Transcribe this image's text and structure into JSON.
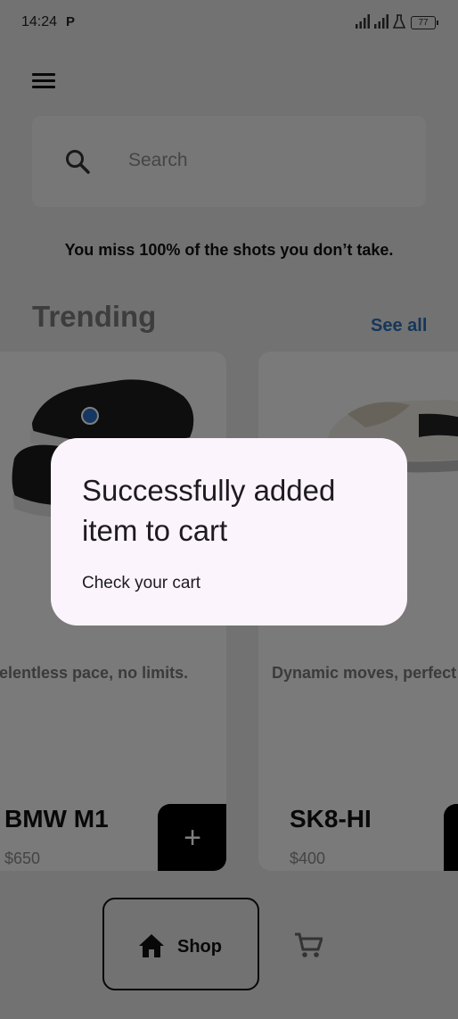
{
  "status_bar": {
    "time": "14:24",
    "notification_icon": "P",
    "battery": "77"
  },
  "search": {
    "placeholder": "Search"
  },
  "quote": "You miss 100% of the shots you don’t take.",
  "section": {
    "title": "Trending",
    "see_all": "See all"
  },
  "products": [
    {
      "name": "BMW M1",
      "price": "$650",
      "description": "Relentless pace, no limits.",
      "add_label": "+"
    },
    {
      "name": "SK8-HI",
      "price": "$400",
      "description": "Dynamic moves, perfect style."
    }
  ],
  "bottom_nav": {
    "shop_label": "Shop"
  },
  "dialog": {
    "title": "Successfully added item to cart",
    "body": "Check your cart"
  },
  "colors": {
    "accent": "#2b6fb8",
    "dialog_bg": "#fcf4fc",
    "scrim": "rgba(0,0,0,0.5)"
  }
}
